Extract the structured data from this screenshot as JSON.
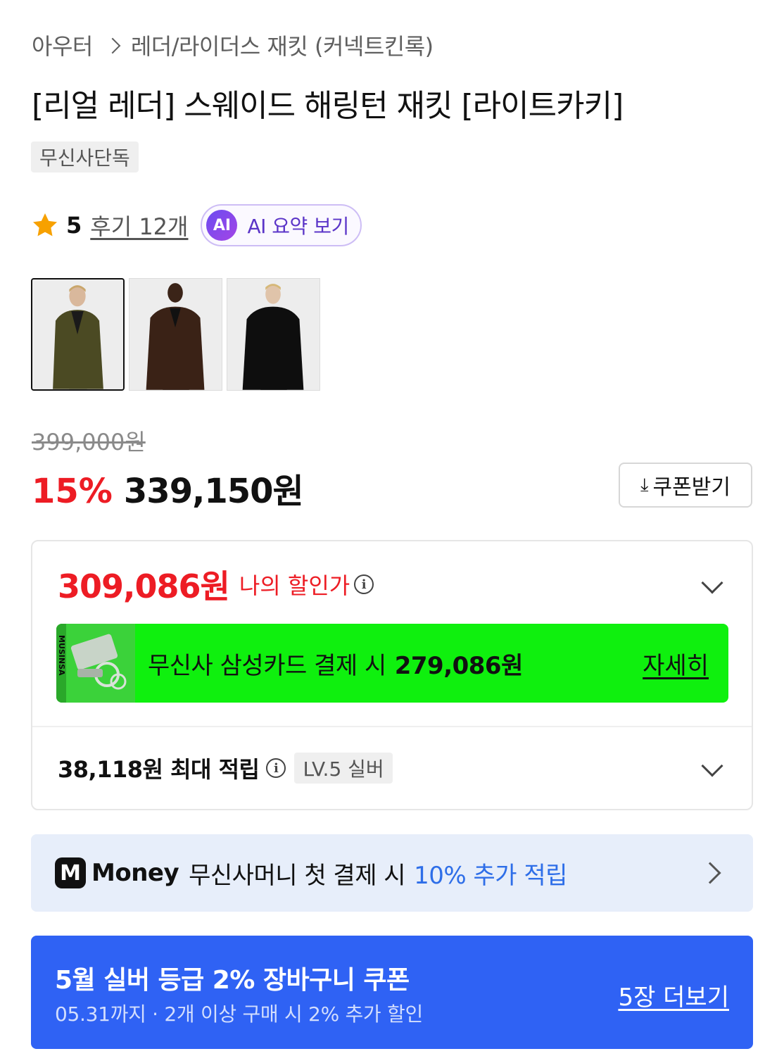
{
  "breadcrumb": {
    "category": "아우터",
    "subcategory": "레더/라이더스 재킷 (커넥트킨록)"
  },
  "product": {
    "title": "[리얼 레더] 스웨이드 해링턴 재킷 [라이트카키]",
    "exclusive_badge": "무신사단독",
    "rating": "5",
    "review_link": "후기 12개",
    "ai_badge": "AI",
    "ai_summary_label": "AI 요약 보기",
    "thumbnails": [
      {
        "jacket_color": "#4b4a23",
        "selected": true
      },
      {
        "jacket_color": "#3a2216",
        "selected": false
      },
      {
        "jacket_color": "#0e0e0e",
        "selected": false
      }
    ]
  },
  "pricing": {
    "original_price": "399,000원",
    "discount_rate": "15%",
    "sale_price": "339,150원",
    "coupon_button": "쿠폰받기"
  },
  "benefits": {
    "my_price": "309,086원",
    "my_price_label": "나의 할인가",
    "samsung_text": "무신사 삼성카드 결제 시",
    "samsung_price": "279,086원",
    "samsung_detail": "자세히",
    "points_text": "38,118원 최대 적립",
    "level_badge": "LV.5 실버"
  },
  "money_banner": {
    "logo": "M",
    "brand": "Money",
    "text": "무신사머니 첫 결제 시",
    "highlight": "10% 추가 적립"
  },
  "coupon_banner": {
    "title": "5월 실버 등급 2% 장바구니 쿠폰",
    "subtitle": "05.31까지 · 2개 이상 구매 시 2% 추가 할인",
    "more_link": "5장 더보기"
  },
  "colors": {
    "sale_red": "#ed1c24",
    "samsung_green": "#0ff00e",
    "coupon_blue": "#2f62f4",
    "money_bg": "#e7eefa",
    "ai_purple": "#5b35c8"
  }
}
